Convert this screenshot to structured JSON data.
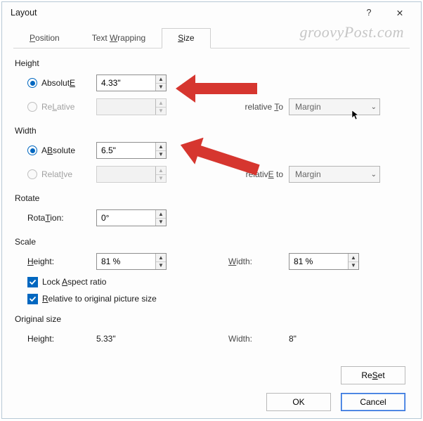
{
  "window": {
    "title": "Layout",
    "help": "?",
    "close": "✕"
  },
  "watermark": "groovyPost.com",
  "tabs": {
    "position": "Position",
    "wrapping": "Text Wrapping",
    "size": "Size"
  },
  "height": {
    "section": "Height",
    "absolute": "Absolute",
    "absolute_acc": "E",
    "absolute_value": "4.33\"",
    "relative": "Relative",
    "relative_acc": "L",
    "relative_value": "",
    "relative_to": "relative to",
    "relative_to_acc": "T",
    "relative_to_value": "Margin"
  },
  "width": {
    "section": "Width",
    "absolute": "Absolute",
    "absolute_acc": "B",
    "absolute_value": "6.5\"",
    "relative": "Relative",
    "relative_acc": "I",
    "relative_value": "",
    "relative_to": "relative to",
    "relative_to_acc": "E",
    "relative_to_value": "Margin"
  },
  "rotate": {
    "section": "Rotate",
    "label": "Rotation:",
    "label_acc": "T",
    "value": "0°"
  },
  "scale": {
    "section": "Scale",
    "height_label": "Height:",
    "height_acc": "H",
    "height_value": "81 %",
    "width_label": "Width:",
    "width_acc": "W",
    "width_value": "81 %",
    "lock": "Lock aspect ratio",
    "lock_acc": "A",
    "rel_orig": "Relative to original picture size",
    "rel_orig_acc": "R"
  },
  "original": {
    "section": "Original size",
    "height_label": "Height:",
    "height_value": "5.33\"",
    "width_label": "Width:",
    "width_value": "8\""
  },
  "buttons": {
    "reset": "Reset",
    "reset_acc": "S",
    "ok": "OK",
    "cancel": "Cancel"
  }
}
